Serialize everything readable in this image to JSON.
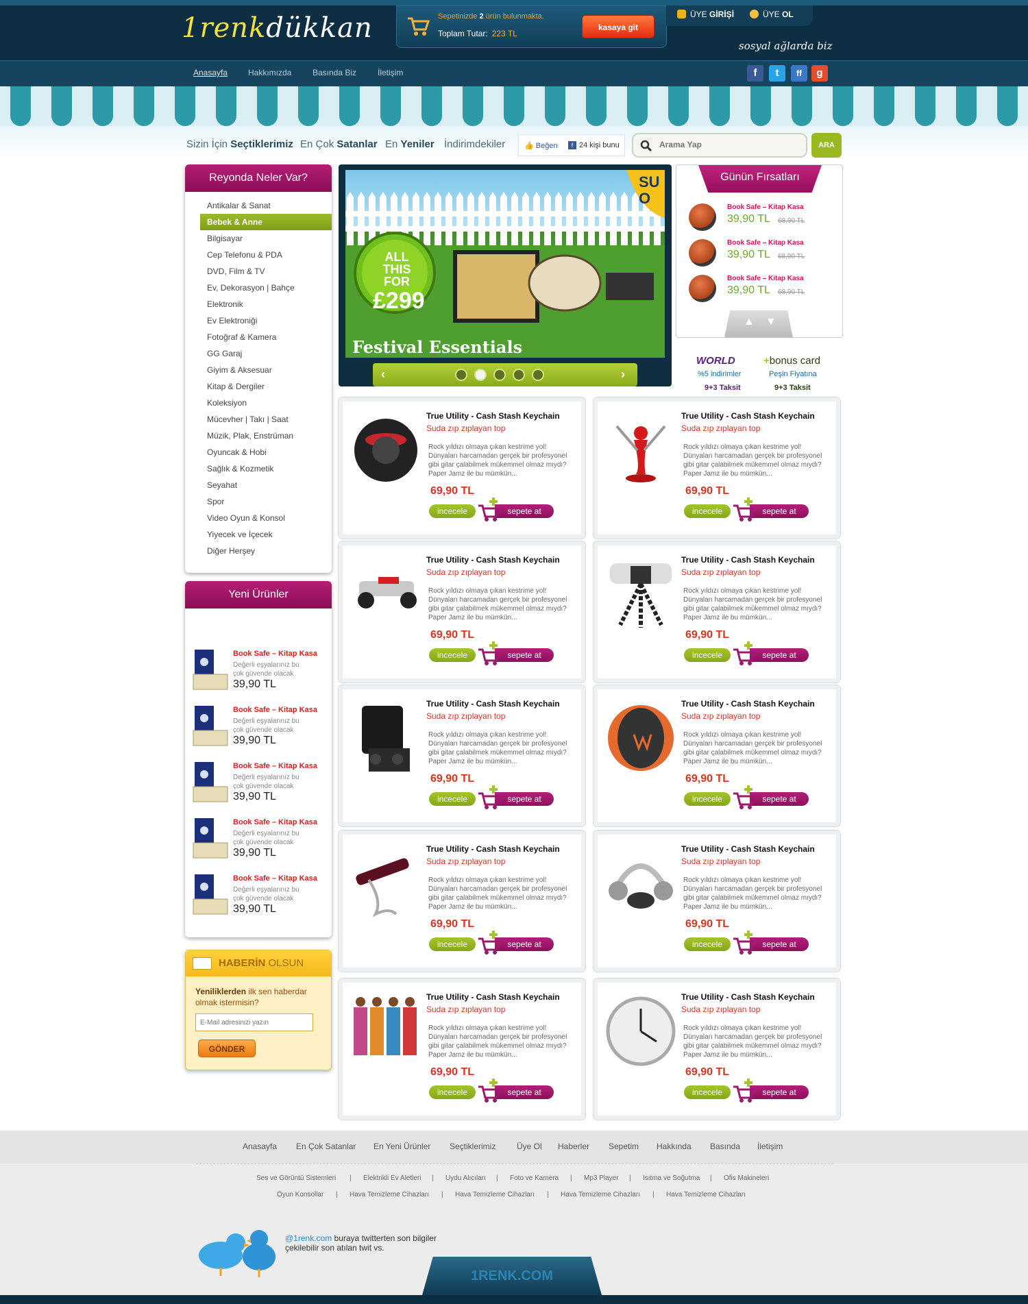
{
  "header": {
    "logo_prefix": "1renk",
    "logo_suffix": "dükkan",
    "cart_line_pre": "Sepetinizde ",
    "cart_count": "2",
    "cart_line_post": " ürün bulunmakta.",
    "total_label": "Toplam Tutar:",
    "total_value": "223 TL",
    "checkout_button": "kasaya git",
    "login_pre": "ÜYE ",
    "login_bold": "GİRİŞİ",
    "register_pre": "ÜYE ",
    "register_bold": "OL",
    "social_text": "sosyal ağlarda biz"
  },
  "nav": [
    "Anasayfa",
    "Hakkımızda",
    "Basında Biz",
    "İletişim"
  ],
  "social_icons": [
    {
      "name": "facebook-icon",
      "glyph": "f",
      "color": "#3b5998"
    },
    {
      "name": "twitter-icon",
      "glyph": "t",
      "color": "#2aa3e8"
    },
    {
      "name": "friendfeed-icon",
      "glyph": "ff",
      "color": "#3a79c7"
    },
    {
      "name": "google-icon",
      "glyph": "g",
      "color": "#e44d2d"
    }
  ],
  "tabs": [
    {
      "pre": "Sizin İçin ",
      "bold": "Seçtiklerimiz"
    },
    {
      "pre": "En Çok ",
      "bold": "Satanlar"
    },
    {
      "pre": "En ",
      "bold": "Yeniler"
    },
    {
      "pre": "İndirimdekiler",
      "bold": ""
    }
  ],
  "like": {
    "button": "Beğen",
    "count": "24 kişi bunu"
  },
  "search": {
    "placeholder": "Arama Yap",
    "button": "ARA"
  },
  "categories": {
    "title": "Reyonda Neler Var?",
    "items": [
      "Antikalar & Sanat",
      "Bebek & Anne",
      "Bilgisayar",
      "Cep Telefonu & PDA",
      "DVD, Film & TV",
      "Ev, Dekorasyon | Bahçe",
      "Elektronik",
      "Ev Elektroniği",
      "Fotoğraf & Kamera",
      "GG Garaj",
      "Giyim & Aksesuar",
      "Kitap & Dergiler",
      "Koleksiyon",
      "Mücevher | Takı | Saat",
      "Müzik, Plak, Enstrüman",
      "Oyuncak & Hobi",
      "Sağlık & Kozmetik",
      "Seyahat",
      "Spor",
      "Video Oyun & Konsol",
      "Yiyecek ve İçecek",
      "Diğer Herşey"
    ],
    "active": "Bebek & Anne"
  },
  "new_products": {
    "title": "Yeni Ürünler",
    "items": [
      {
        "name": "Book Safe – Kitap Kasa",
        "desc": "Değerli eşyalarınız bu çok güvende olacak",
        "price": "39,90 TL"
      },
      {
        "name": "Book Safe – Kitap Kasa",
        "desc": "Değerli eşyalarınız bu çok güvende olacak",
        "price": "39,90 TL"
      },
      {
        "name": "Book Safe – Kitap Kasa",
        "desc": "Değerli eşyalarınız bu çok güvende olacak",
        "price": "39,90 TL"
      },
      {
        "name": "Book Safe – Kitap Kasa",
        "desc": "Değerli eşyalarınız bu çok güvende olacak",
        "price": "39,90 TL"
      },
      {
        "name": "Book Safe – Kitap Kasa",
        "desc": "Değerli eşyalarınız bu çok güvende olacak",
        "price": "39,90 TL"
      }
    ]
  },
  "newsletter": {
    "title_bold": "HABERİN",
    "title_rest": " OLSUN",
    "text_bold": "Yeniliklerden",
    "text_rest": " ilk sen haberdar olmak istermisin?",
    "placeholder": "E-Mail adresinizi yazın",
    "button": "GÖNDER"
  },
  "slider": {
    "badge_line1": "ALL",
    "badge_line2": "THIS FOR",
    "badge_price": "£299",
    "caption": "Festival Essentials",
    "corner_text": "SU O",
    "dot_count": 5,
    "active_dot": 2
  },
  "deals": {
    "title": "Günün Fırsatları",
    "items": [
      {
        "name": "Book Safe – Kitap Kasa",
        "price": "39,90 TL",
        "old": "68,90 TL"
      },
      {
        "name": "Book Safe – Kitap Kasa",
        "price": "39,90 TL",
        "old": "68,90 TL"
      },
      {
        "name": "Book Safe – Kitap Kasa",
        "price": "39,90 TL",
        "old": "68,90 TL"
      }
    ]
  },
  "cards": {
    "world": "WORLD",
    "bonus_plus": "+",
    "bonus": "bonus card",
    "world_line1": "%5 indirimler",
    "world_line2": "9+3 Taksit",
    "bonus_line1": "Peşin Fiyatına",
    "bonus_line2": "9+3 Taksit"
  },
  "products": [
    {
      "icon": "speaker-icon",
      "title": "True Utility - Cash Stash Keychain",
      "subtitle": "Suda zıp zıplayan top",
      "desc": "Rock yıldızı olmaya çıkan kestrime yol! Dünyaları harcamadan gerçek bir profesyonel gibi gitar çalabilmek mükemmel olmaz mıydı? Paper Jamz ile bu mümkün...",
      "price": "69,90 TL",
      "btn_view": "incecele",
      "btn_cart": "sepete at"
    },
    {
      "icon": "knife-block-icon",
      "title": "True Utility - Cash Stash Keychain",
      "subtitle": "Suda zıp zıplayan top",
      "desc": "Rock yıldızı olmaya çıkan kestrime yol! Dünyaları harcamadan gerçek bir profesyonel gibi gitar çalabilmek mükemmel olmaz mıydı? Paper Jamz ile bu mümkün...",
      "price": "69,90 TL",
      "btn_view": "incecele",
      "btn_cart": "sepete at"
    },
    {
      "icon": "rc-car-icon",
      "title": "True Utility - Cash Stash Keychain",
      "subtitle": "Suda zıp zıplayan top",
      "desc": "Rock yıldızı olmaya çıkan kestrime yol! Dünyaları harcamadan gerçek bir profesyonel gibi gitar çalabilmek mükemmel olmaz mıydı? Paper Jamz ile bu mümkün...",
      "price": "69,90 TL",
      "btn_view": "incecele",
      "btn_cart": "sepete at"
    },
    {
      "icon": "camera-tripod-icon",
      "title": "True Utility - Cash Stash Keychain",
      "subtitle": "Suda zıp zıplayan top",
      "desc": "Rock yıldızı olmaya çıkan kestrime yol! Dünyaları harcamadan gerçek bir profesyonel gibi gitar çalabilmek mükemmel olmaz mıydı? Paper Jamz ile bu mümkün...",
      "price": "69,90 TL",
      "btn_view": "incecele",
      "btn_cart": "sepete at"
    },
    {
      "icon": "console-stand-icon",
      "title": "True Utility - Cash Stash Keychain",
      "subtitle": "Suda zıp zıplayan top",
      "desc": "Rock yıldızı olmaya çıkan kestrime yol! Dünyaları harcamadan gerçek bir profesyonel gibi gitar çalabilmek mükemmel olmaz mıydı? Paper Jamz ile bu mümkün...",
      "price": "69,90 TL",
      "btn_view": "incecele",
      "btn_cart": "sepete at"
    },
    {
      "icon": "ball-icon",
      "title": "True Utility - Cash Stash Keychain",
      "subtitle": "Suda zıp zıplayan top",
      "desc": "Rock yıldızı olmaya çıkan kestrime yol! Dünyaları harcamadan gerçek bir profesyonel gibi gitar çalabilmek mükemmel olmaz mıydı? Paper Jamz ile bu mümkün...",
      "price": "69,90 TL",
      "btn_view": "incecele",
      "btn_cart": "sepete at"
    },
    {
      "icon": "wine-holder-icon",
      "title": "True Utility - Cash Stash Keychain",
      "subtitle": "Suda zıp zıplayan top",
      "desc": "Rock yıldızı olmaya çıkan kestrime yol! Dünyaları harcamadan gerçek bir profesyonel gibi gitar çalabilmek mükemmel olmaz mıydı? Paper Jamz ile bu mümkün...",
      "price": "69,90 TL",
      "btn_view": "incecele",
      "btn_cart": "sepete at"
    },
    {
      "icon": "headphones-icon",
      "title": "True Utility - Cash Stash Keychain",
      "subtitle": "Suda zıp zıplayan top",
      "desc": "Rock yıldızı olmaya çıkan kestrime yol! Dünyaları harcamadan gerçek bir profesyonel gibi gitar çalabilmek mükemmel olmaz mıydı? Paper Jamz ile bu mümkün...",
      "price": "69,90 TL",
      "btn_view": "incecele",
      "btn_cart": "sepete at"
    },
    {
      "icon": "aprons-icon",
      "title": "True Utility - Cash Stash Keychain",
      "subtitle": "Suda zıp zıplayan top",
      "desc": "Rock yıldızı olmaya çıkan kestrime yol! Dünyaları harcamadan gerçek bir profesyonel gibi gitar çalabilmek mükemmel olmaz mıydı? Paper Jamz ile bu mümkün...",
      "price": "69,90 TL",
      "btn_view": "incecele",
      "btn_cart": "sepete at"
    },
    {
      "icon": "clock-icon",
      "title": "True Utility - Cash Stash Keychain",
      "subtitle": "Suda zıp zıplayan top",
      "desc": "Rock yıldızı olmaya çıkan kestrime yol! Dünyaları harcamadan gerçek bir profesyonel gibi gitar çalabilmek mükemmel olmaz mıydı? Paper Jamz ile bu mümkün...",
      "price": "69,90 TL",
      "btn_view": "incecele",
      "btn_cart": "sepete at"
    }
  ],
  "footer": {
    "links": [
      "Anasayfa",
      "En Çok Satanlar",
      "En Yeni Ürünler",
      "Seçtiklerimiz",
      "Üye Ol",
      "Haberler",
      "Sepetim",
      "Hakkında",
      "Basında",
      "İletişim"
    ],
    "row1": [
      "Ses ve Görüntü Sistemleri",
      "Elektrikli Ev Aletleri",
      "Uydu Alıcıları",
      "Foto ve Kamera",
      "Mp3 Player",
      "Isıtma ve Soğutma",
      "Ofis Makineleri"
    ],
    "row2": [
      "Oyun Konsollar",
      "Hava Temizleme Cihazları",
      "Hava Temizleme Cihazları",
      "Hava Temizleme Cihazları",
      "Hava Temizleme Cihazları"
    ],
    "separator": "|",
    "twitter_handle": "@1renk.com",
    "twitter_text": " buraya twitterten son bilgiler çekilebilir son atılan twit vs.",
    "brand": "1RENK.COM"
  }
}
